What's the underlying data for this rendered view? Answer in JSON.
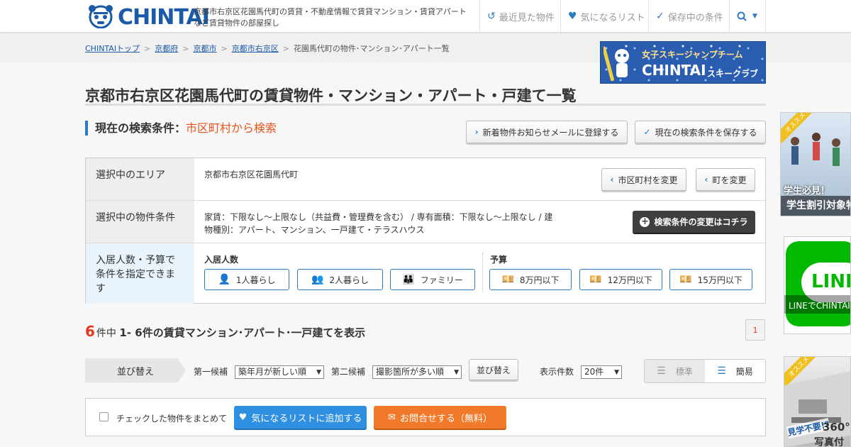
{
  "header": {
    "logo_text": "CHINTAI",
    "tagline": "京都市右京区花園馬代町の賃貸・不動産情報で賃貸マンション・賃貸アパートなど賃貸物件の部屋探し",
    "nav": [
      {
        "label": "最近見た物件",
        "icon": "history-icon"
      },
      {
        "label": "気になるリスト",
        "icon": "heart-icon"
      },
      {
        "label": "保存中の条件",
        "icon": "check-icon"
      }
    ]
  },
  "breadcrumb": [
    "CHINTAIトップ",
    "京都府",
    "京都市",
    "京都市右京区",
    "花園馬代町の物件･マンション･アパート一覧"
  ],
  "banner": {
    "line1": "女子スキージャンプチーム",
    "line2": "CHINTAI",
    "line3": "スキークラブ"
  },
  "page_title": "京都市右京区花園馬代町の賃貸物件・マンション・アパート・戸建て一覧",
  "search_condition": {
    "label": "現在の検索条件：",
    "value": "市区町村から検索",
    "mail_button": "新着物件お知らせメールに登録する",
    "save_button": "現在の検索条件を保存する"
  },
  "conditions": {
    "area_head": "選択中のエリア",
    "area_value": "京都市右京区花園馬代町",
    "change_city": "市区町村を変更",
    "change_town": "町を変更",
    "property_head": "選択中の物件条件",
    "property_value": "家賃：下限なし～上限なし（共益費・管理費を含む） / 専有面積：下限なし～上限なし / 建物種別：アパート、マンション、一戸建て・テラスハウス",
    "change_conditions": "検索条件の変更はコチラ",
    "budget_head": "入居人数・予算で条件を指定できます",
    "occupants_label": "入居人数",
    "occupants": [
      "1人暮らし",
      "2人暮らし",
      "ファミリー"
    ],
    "budget_label": "予算",
    "budgets": [
      "8万円以下",
      "12万円以下",
      "15万円以下"
    ]
  },
  "results": {
    "total": "6",
    "count_prefix": "件中",
    "count_text": "1- 6件の賃貸マンション･アパート･一戸建てを表示",
    "page": "1"
  },
  "sort": {
    "label": "並び替え",
    "first_label": "第一候補",
    "first_value": "築年月が新しい順",
    "second_label": "第二候補",
    "second_value": "撮影箇所が多い順",
    "sort_button": "並び替え",
    "per_page_label": "表示件数",
    "per_page_value": "20件",
    "view_standard": "標準",
    "view_simple": "簡易"
  },
  "bulk": {
    "check_label": "チェックした物件をまとめて",
    "favorite_button": "気になるリストに追加する",
    "inquiry_button": "お問合せする（無料）"
  },
  "side_ads": {
    "ad1_ribbon": "オススメ",
    "ad1_line1": "学生必見！",
    "ad1_line2": "学生割引対象物件",
    "ad2_text": "LINEでCHINTAI",
    "ad2_logo": "LINE",
    "ad3_ribbon": "オススメ",
    "ad3_line1": "見学不要!?",
    "ad3_line2": "360°",
    "ad3_line3": "写真付き"
  },
  "colors": {
    "accent_blue": "#2a7bc4",
    "accent_orange": "#e8541e",
    "count_red": "#e8341e"
  }
}
